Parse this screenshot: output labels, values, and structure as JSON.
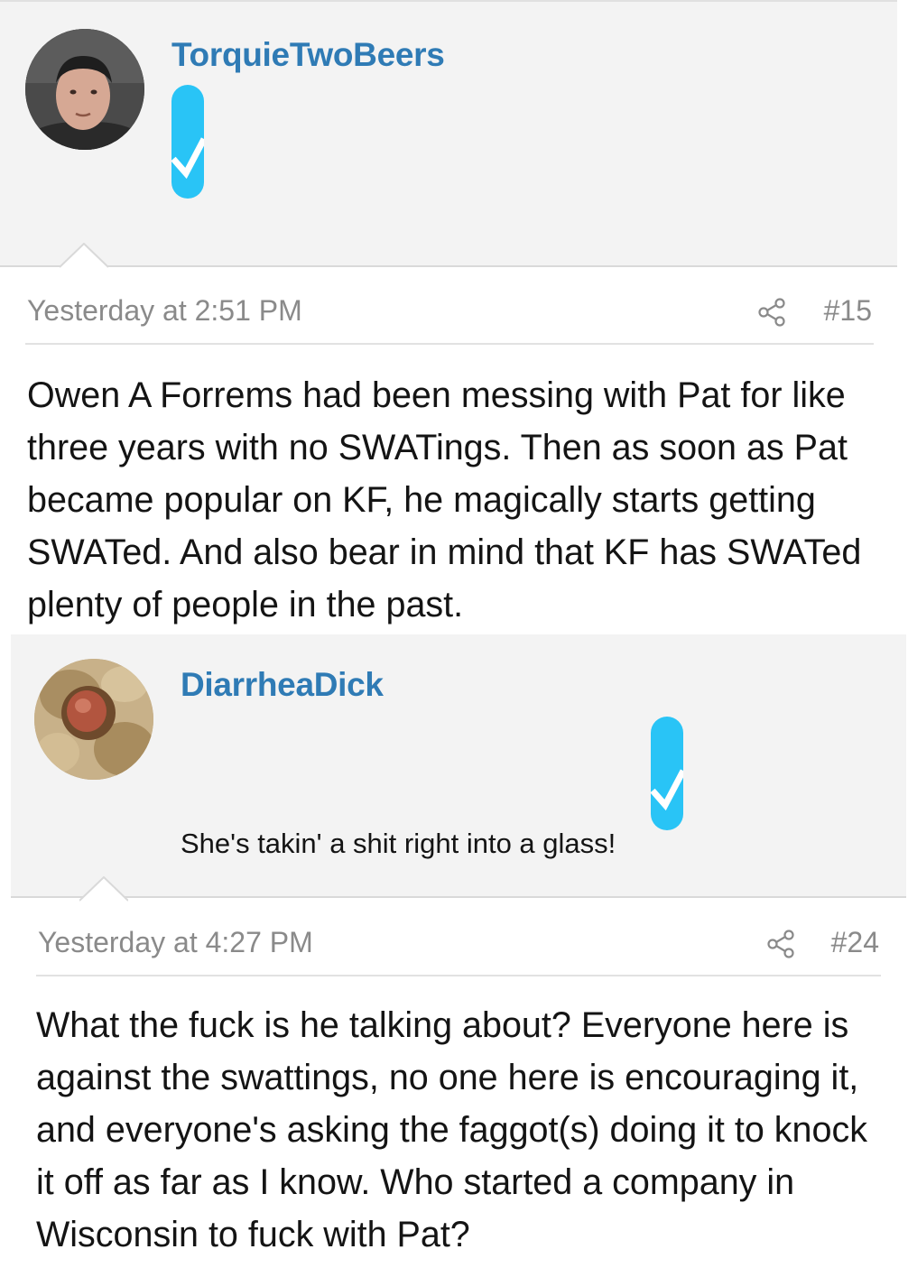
{
  "posts": [
    {
      "username": "TorquieTwoBeers",
      "avatar_icon": "avatar-photo",
      "badge_icon": "verified-badge-icon",
      "badge_color": "#29c4f6",
      "user_title": "",
      "date": "Yesterday at 2:51 PM",
      "post_number": "#15",
      "text": "Owen A Forrems had been messing with Pat for like three years with no SWATings. Then as soon as Pat became popular on KF, he magically starts getting SWATed. And also bear in mind that KF has SWATed plenty of people in the past."
    },
    {
      "username": "DiarrheaDick",
      "avatar_icon": "avatar-photo",
      "badge_icon": "verified-badge-icon",
      "badge_color": "#29c4f6",
      "user_title": "She's takin' a shit right into a glass!",
      "date": "Yesterday at 4:27 PM",
      "post_number": "#24",
      "text": "What the fuck is he talking about? Everyone here is against the swattings, no one here is encouraging it, and everyone's asking the faggot(s) doing it to knock it off as far as I know. Who started a company in Wisconsin to fuck with Pat?"
    }
  ],
  "colors": {
    "username": "#2f7bb5",
    "meta_text": "#8a8a8a",
    "user_block_bg": "#f3f3f3",
    "body_text": "#141414"
  }
}
